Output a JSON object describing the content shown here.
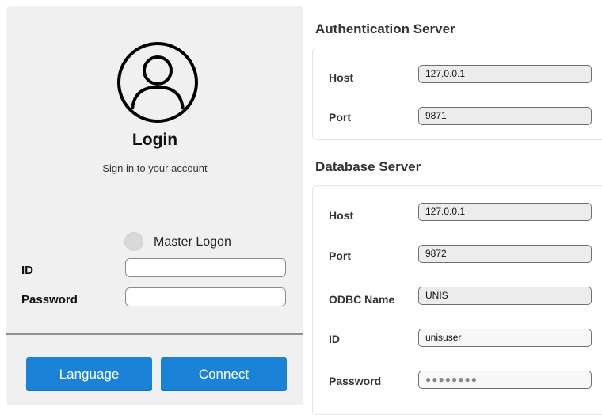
{
  "login": {
    "title": "Login",
    "subtitle": "Sign in to your account",
    "master_logon_label": "Master Logon",
    "id_label": "ID",
    "password_label": "Password",
    "id_value": "",
    "password_value": "",
    "language_button": "Language",
    "connect_button": "Connect"
  },
  "auth_server": {
    "title": "Authentication Server",
    "host_label": "Host",
    "host_value": "127.0.0.1",
    "port_label": "Port",
    "port_value": "9871"
  },
  "db_server": {
    "title": "Database Server",
    "host_label": "Host",
    "host_value": "127.0.0.1",
    "port_label": "Port",
    "port_value": "9872",
    "odbc_label": "ODBC Name",
    "odbc_value": "UNIS",
    "id_label": "ID",
    "id_value": "unisuser",
    "password_label": "Password",
    "password_value": "●●●●●●●●"
  },
  "colors": {
    "accent_button": "#1a83d8",
    "panel_bg": "#f0f0f0"
  },
  "icons": {
    "avatar": "user-circle-icon"
  }
}
